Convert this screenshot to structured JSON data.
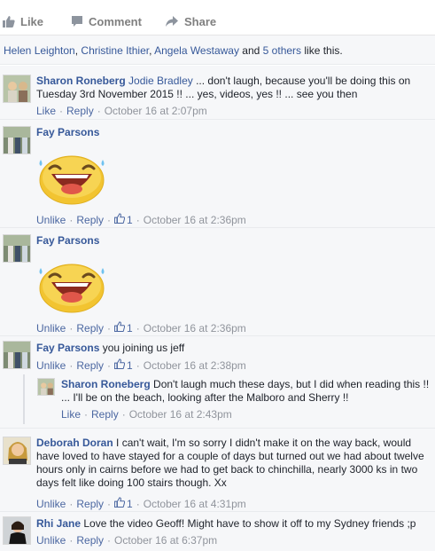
{
  "actions": {
    "like": "Like",
    "comment": "Comment",
    "share": "Share"
  },
  "likes": {
    "p1": "Helen Leighton",
    "sep1": ", ",
    "p2": "Christine Ithier",
    "sep2": ", ",
    "p3": "Angela Westaway",
    "and": " and ",
    "others": "5 others",
    "tail": " like this."
  },
  "comments": [
    {
      "author": "Sharon Roneberg",
      "mention": "Jodie Bradley",
      "text": " ... don't laugh, because you'll be doing this on Tuesday 3rd November 2015 !! ... yes, videos, yes !! ... see you then",
      "action1": "Like",
      "reply": "Reply",
      "time": "October 16 at 2:07pm"
    },
    {
      "author": "Fay Parsons",
      "sticker": "laughing-sticker",
      "action1": "Unlike",
      "reply": "Reply",
      "count": "1",
      "time": "October 16 at 2:36pm"
    },
    {
      "author": "Fay Parsons",
      "sticker": "laughing-sticker",
      "action1": "Unlike",
      "reply": "Reply",
      "count": "1",
      "time": "October 16 at 2:36pm"
    },
    {
      "author": "Fay Parsons",
      "text": " you joining us jeff",
      "action1": "Unlike",
      "reply": "Reply",
      "count": "1",
      "time": "October 16 at 2:38pm"
    },
    {
      "author": "Sharon Roneberg",
      "text": " Don't laugh much these days, but I did when reading this !! ... I'll be on the beach, looking after the Malboro and Sherry !!",
      "action1": "Like",
      "reply": "Reply",
      "time": "October 16 at 2:43pm"
    },
    {
      "author": "Deborah Doran",
      "text": " I can't wait, I'm so sorry I didn't make it on the way back, would have loved to have stayed for a couple of days but turned out we had about twelve hours only in cairns before we had to get back to chinchilla, nearly 3000 ks in two days felt like doing 100 stairs though. Xx",
      "action1": "Unlike",
      "reply": "Reply",
      "count": "1",
      "time": "October 16 at 4:31pm"
    },
    {
      "author": "Rhi Jane",
      "text": " Love the video Geoff! Might have to show it off to my Sydney friends ;p",
      "action1": "Unlike",
      "reply": "Reply",
      "time": "October 16 at 6:37pm"
    }
  ]
}
